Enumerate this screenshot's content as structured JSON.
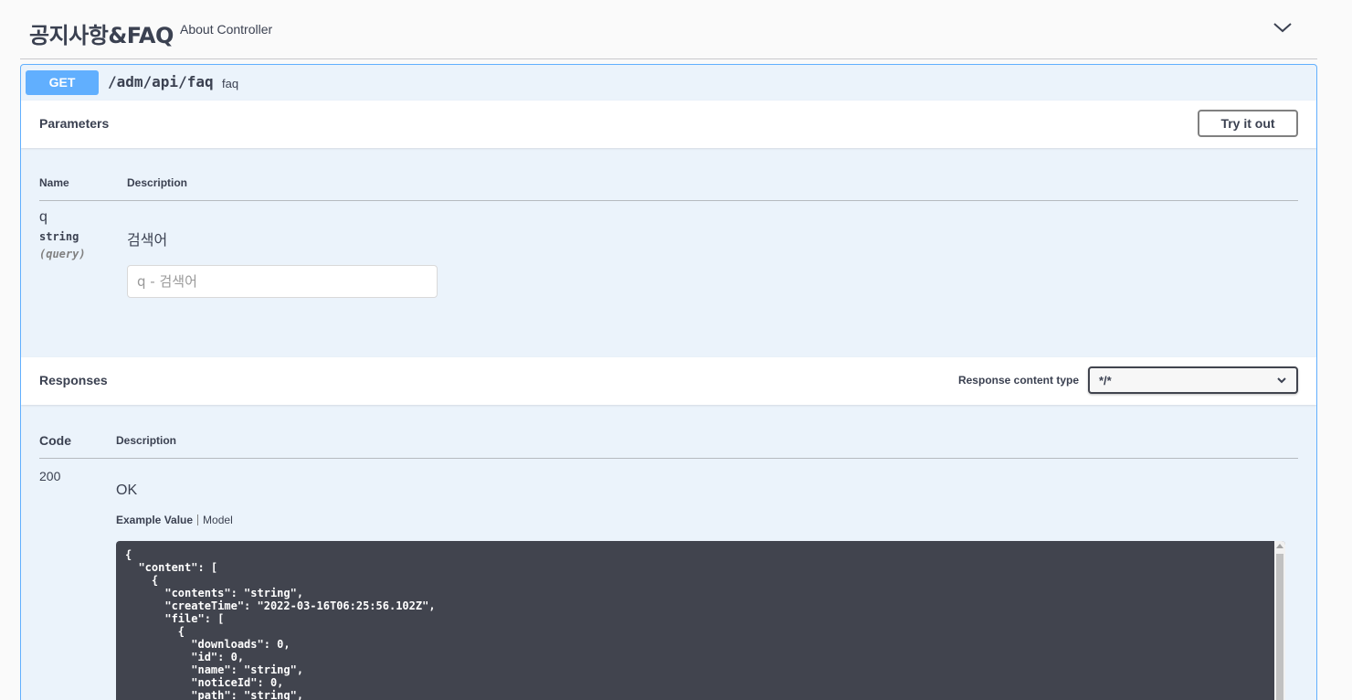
{
  "tag": {
    "title": "공지사항&FAQ",
    "description": "About Controller",
    "toggle_icon": "chevron-down-icon"
  },
  "operation": {
    "method": "GET",
    "path": "/adm/api/faq",
    "summary": "faq",
    "accent_color": "#61affe"
  },
  "parameters": {
    "title": "Parameters",
    "try_button": "Try it out",
    "columns": [
      "Name",
      "Description"
    ],
    "items": [
      {
        "name": "q",
        "type": "string",
        "in": "(query)",
        "description": "검색어",
        "placeholder": "q - 검색어"
      }
    ]
  },
  "responses": {
    "title": "Responses",
    "content_type_label": "Response content type",
    "content_type_value": "*/*",
    "columns": [
      "Code",
      "Description"
    ],
    "items": [
      {
        "code": "200",
        "description": "OK",
        "tabs": [
          "Example Value",
          "Model"
        ],
        "example": "{\n  \"content\": [\n    {\n      \"contents\": \"string\",\n      \"createTime\": \"2022-03-16T06:25:56.102Z\",\n      \"file\": [\n        {\n          \"downloads\": 0,\n          \"id\": 0,\n          \"name\": \"string\",\n          \"noticeId\": 0,\n          \"path\": \"string\","
      }
    ]
  }
}
